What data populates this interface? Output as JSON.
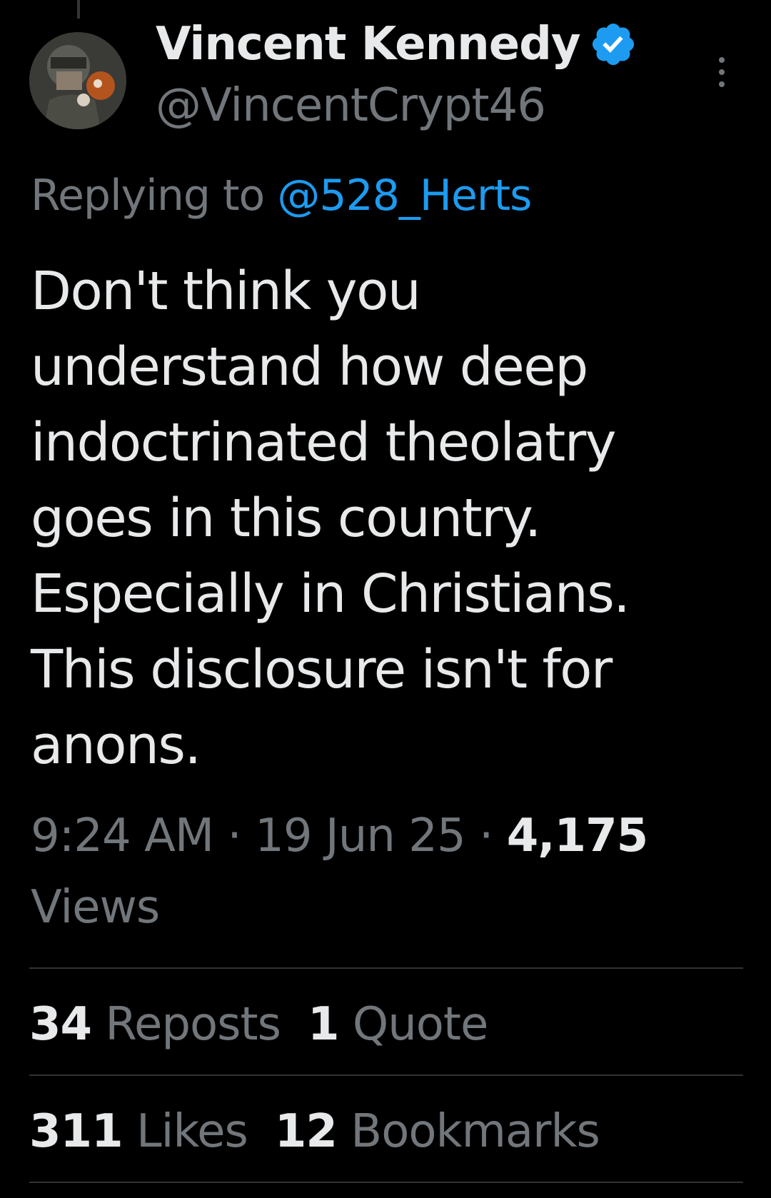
{
  "author": {
    "display_name": "Vincent Kennedy",
    "handle": "@VincentCrypt46",
    "verified": true,
    "avatar_icon": "avatar-photo"
  },
  "reply": {
    "prefix": "Replying to ",
    "mention": "@528_Herts"
  },
  "tweet": {
    "lines": [
      "Don't think you",
      "understand how deep",
      "indoctrinated theolatry",
      "goes in this country.",
      "Especially in Christians.",
      "This disclosure isn't for",
      "anons."
    ]
  },
  "meta": {
    "time": "9:24 AM",
    "separator": " · ",
    "date": "19 Jun 25",
    "views_count": "4,175",
    "views_label": "Views"
  },
  "stats": {
    "reposts": {
      "count": "34",
      "label": "Reposts"
    },
    "quotes": {
      "count": "1",
      "label": "Quote"
    },
    "likes": {
      "count": "311",
      "label": "Likes"
    },
    "bookmarks": {
      "count": "12",
      "label": "Bookmarks"
    }
  },
  "icons": {
    "verified": "verified-badge-icon",
    "more": "more-options-icon"
  },
  "colors": {
    "background": "#000000",
    "text_primary": "#e7e9ea",
    "text_secondary": "#71767b",
    "accent": "#1d9bf0",
    "divider": "#2f3336"
  }
}
